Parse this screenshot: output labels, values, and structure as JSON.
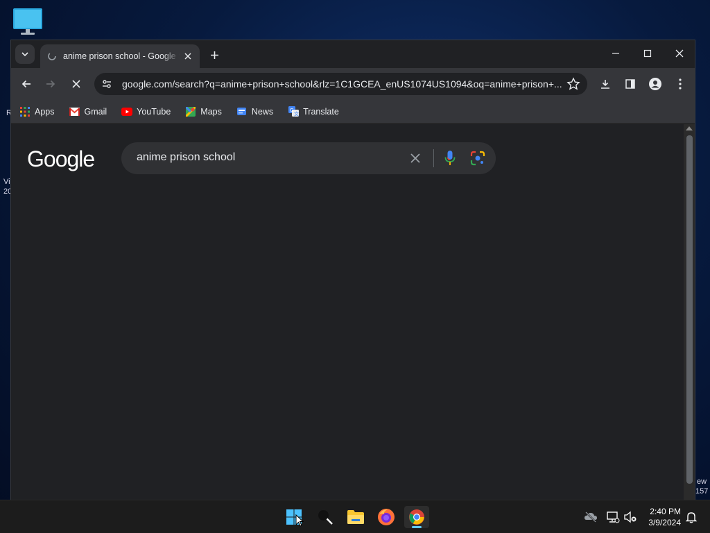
{
  "desktop": {
    "edge_texts": [
      "R",
      "Vi",
      "20",
      "ew",
      "157"
    ]
  },
  "browser": {
    "tab": {
      "title": "anime prison school - Google Search"
    },
    "omnibox": {
      "url": "google.com/search?q=anime+prison+school&rlz=1C1GCEA_enUS1074US1094&oq=anime+prison+..."
    },
    "bookmarks": [
      {
        "label": "Apps",
        "icon": "apps-grid-icon"
      },
      {
        "label": "Gmail",
        "icon": "gmail-icon"
      },
      {
        "label": "YouTube",
        "icon": "youtube-icon"
      },
      {
        "label": "Maps",
        "icon": "maps-icon"
      },
      {
        "label": "News",
        "icon": "news-icon"
      },
      {
        "label": "Translate",
        "icon": "translate-icon"
      }
    ]
  },
  "google": {
    "logo": "Google",
    "search_value": "anime prison school"
  },
  "taskbar": {
    "time": "2:40 PM",
    "date": "3/9/2024"
  },
  "colors": {
    "accent": "#8ab4f8",
    "taskbar_indicator": "#60cdff"
  }
}
